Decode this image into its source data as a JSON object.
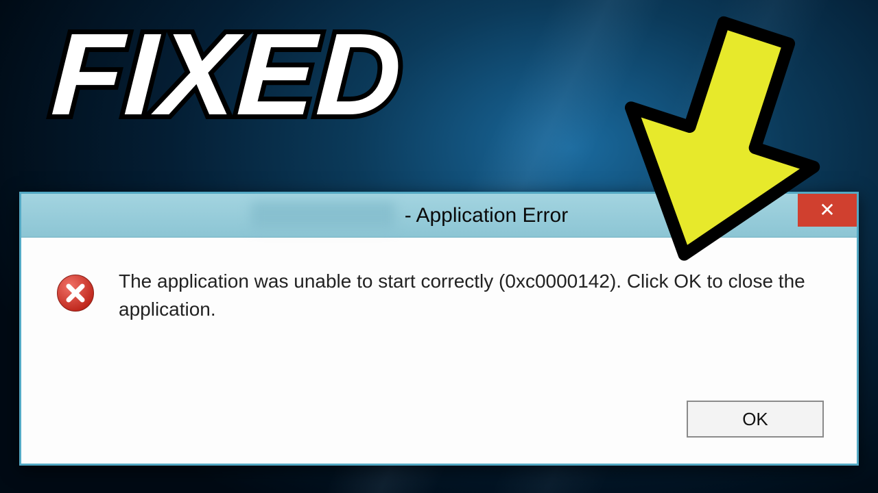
{
  "overlay": {
    "headline": "FIXED"
  },
  "dialog": {
    "title_suffix": "- Application Error",
    "message": "The application was unable to start correctly (0xc0000142). Click OK to close the application.",
    "ok_label": "OK",
    "close_glyph": "✕"
  },
  "colors": {
    "titlebar": "#8cc5d4",
    "close": "#d0402f",
    "arrow_fill": "#e7e92b",
    "arrow_stroke": "#000000"
  }
}
